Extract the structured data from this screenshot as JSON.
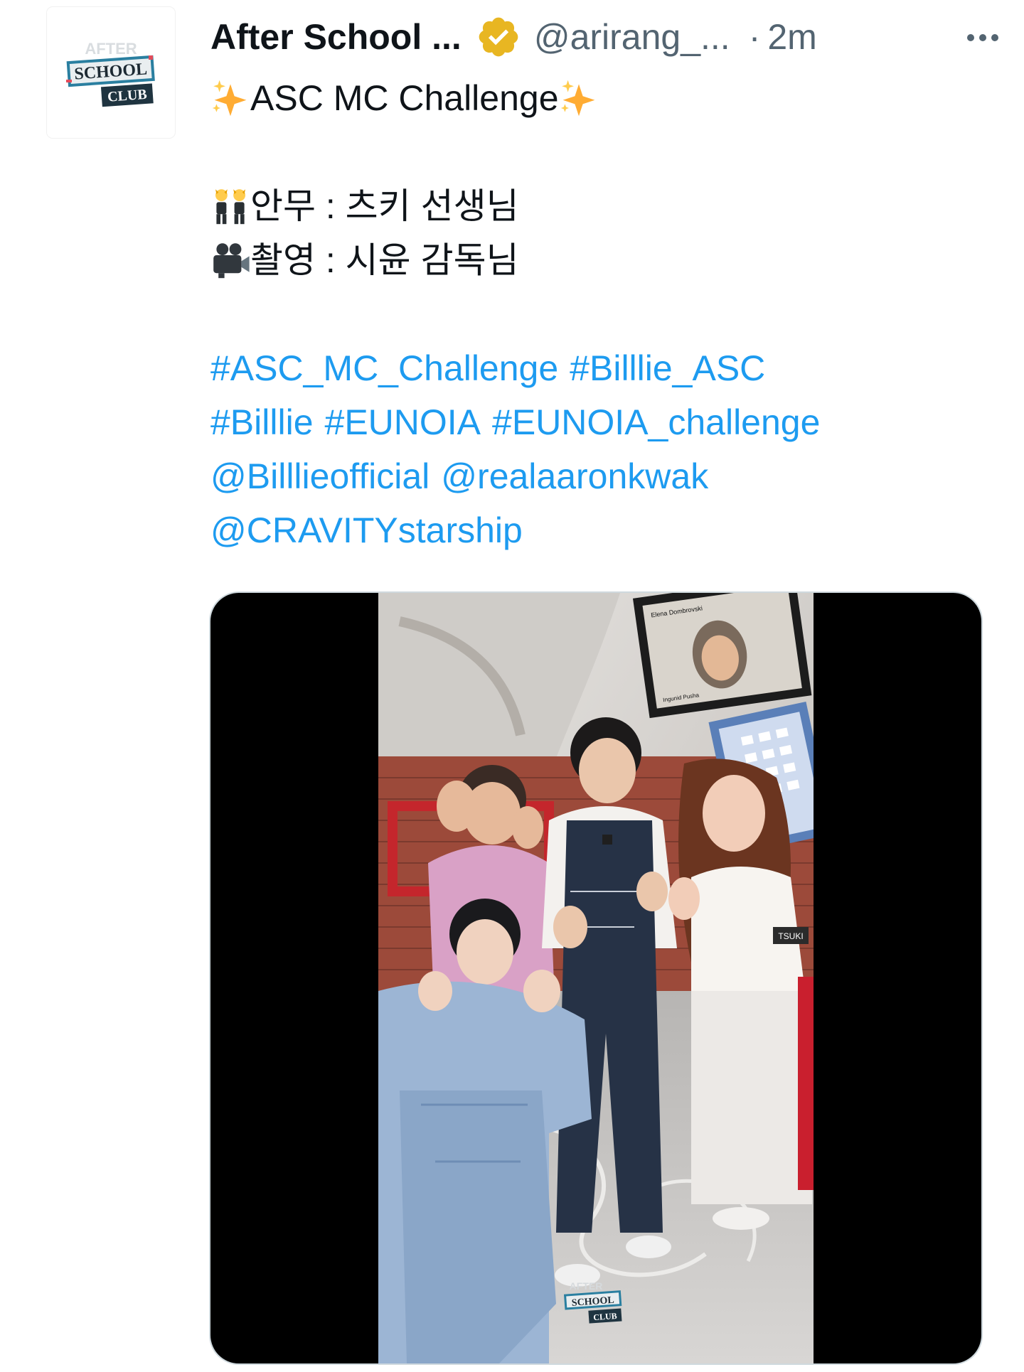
{
  "tweet": {
    "display_name": "After School ...",
    "handle": "@arirang_...",
    "separator": "·",
    "time": "2m",
    "lines": {
      "title": "ASC MC Challenge",
      "choreo": "안무 : 츠키 선생님",
      "film": " 촬영 : 시윤 감독님"
    },
    "links": {
      "row1": [
        "#ASC_MC_Challenge",
        "#Billlie_ASC"
      ],
      "row2": [
        "#Billlie",
        "#EUNOIA",
        "#EUNOIA_challenge"
      ],
      "row3": [
        "@Billlieofficial",
        "@realaaronkwak"
      ],
      "row4": [
        "@CRAVITYstarship"
      ]
    },
    "avatar_logo": {
      "top": "AFTER",
      "mid": "SCHOOL",
      "bot": "CLUB"
    },
    "media_logo": {
      "top": "AFTER",
      "mid": "SCHOOL",
      "bot": "CLUB"
    },
    "video_labels": {
      "caller_top": "Elena Dombrovski",
      "caller_bottom": "Ingunid Pusha",
      "name_tag": "TSUKI"
    }
  },
  "icons": {
    "verified": "verified-badge-icon",
    "more": "more-icon",
    "sparkles": "sparkles-icon",
    "dancers": "dancers-icon",
    "camera": "video-camera-icon"
  },
  "colors": {
    "link": "#1d9bf0",
    "secondary": "#536471",
    "verified": "#e8b622"
  }
}
